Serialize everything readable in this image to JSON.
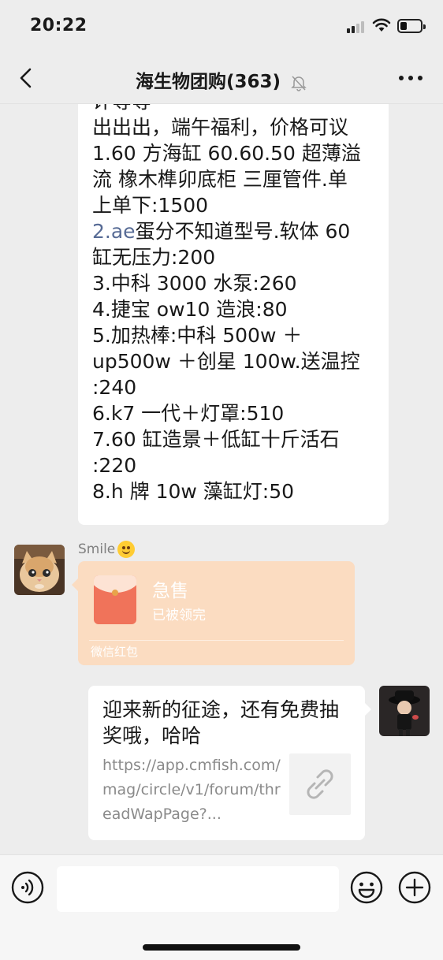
{
  "status_bar": {
    "time": "20:22"
  },
  "nav": {
    "title": "海生物团购(363)"
  },
  "messages": {
    "long_text": [
      "计等等",
      "出出出，端午福利，价格可议",
      "1.60 方海缸 60.60.50 超薄溢",
      "流 橡木榫卯底柜 三厘管件.单",
      "上单下:1500",
      "2.ae|蛋分不知道型号.软体 60",
      "缸无压力:200",
      "3.中科 3000 水泵:260",
      "4.捷宝 ow10 造浪:80",
      "5.加热棒:中科 500w ＋",
      "up500w ＋创星 100w.送温控",
      ":240",
      "6.k7 一代＋灯罩:510",
      "7.60 缸造景＋低缸十斤活石",
      ":220",
      "8.h 牌 10w 藻缸灯:50"
    ],
    "link_part": "2.ae",
    "link_rest": "蛋分不知道型号.软体 60",
    "sender_name": "Smile",
    "red_packet": {
      "title": "急售",
      "status": "已被领完",
      "label": "微信红包"
    },
    "link_card": {
      "title": "迎来新的征途，还有免费抽奖哦，哈哈",
      "url": "https://app.cmfish.com/mag/circle/v1/forum/threadWapPage?..."
    }
  },
  "icons": {
    "back": "chevron-left-icon",
    "mute": "bell-mute-icon",
    "more": "more-dots-icon",
    "voice": "voice-icon",
    "emoji": "smiley-icon",
    "plus": "plus-icon",
    "link": "link-icon"
  },
  "colors": {
    "background": "#ededed",
    "link": "#576b95",
    "red_packet_bg": "#fbdcc1",
    "red_packet_icon": "#f0735a"
  }
}
